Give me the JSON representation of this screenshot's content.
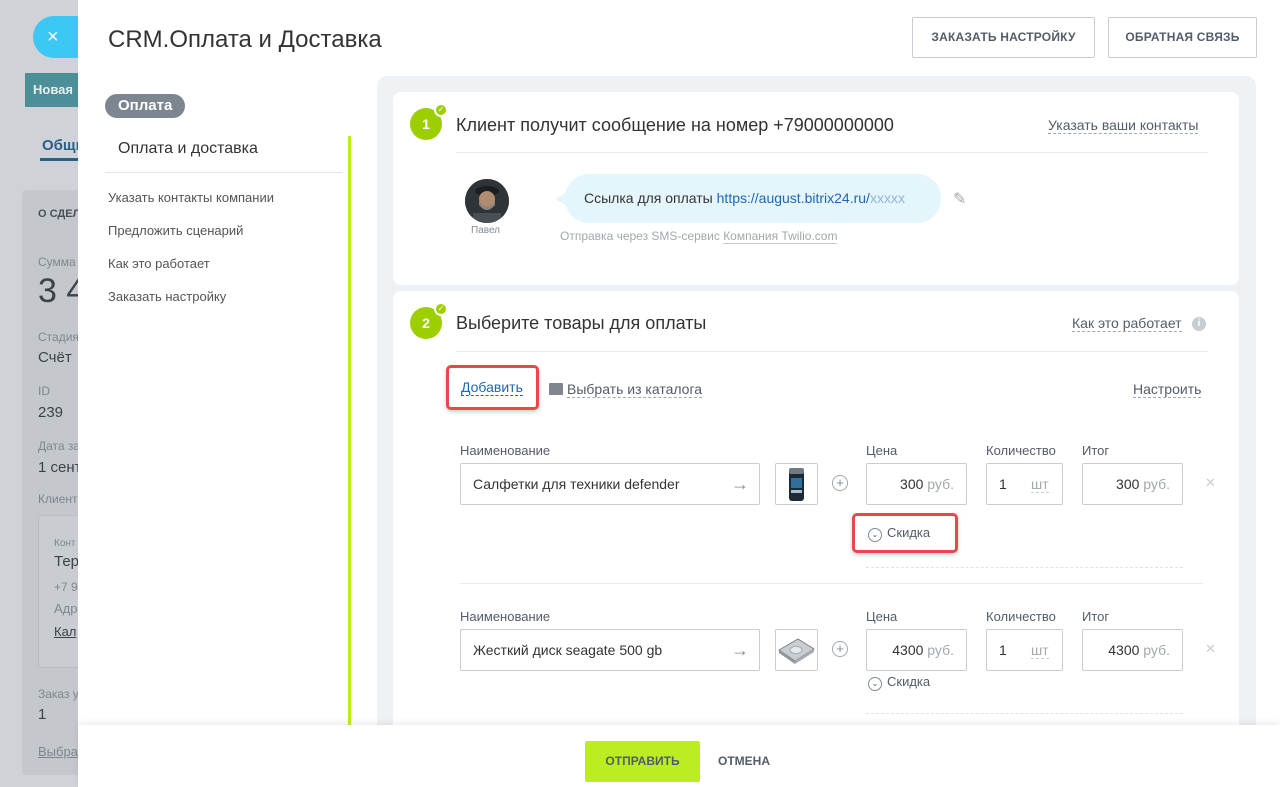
{
  "background": {
    "close_glyph": "×",
    "badge": "Новая",
    "tab": "Общи",
    "section": "О СДЕЛ",
    "fields": [
      {
        "label": "Сумма",
        "value": "3 4"
      },
      {
        "label": "Стадия",
        "value": "Счёт"
      },
      {
        "label": "ID",
        "value": "239"
      },
      {
        "label": "Дата за",
        "value": "1 сент"
      },
      {
        "label": "Клиент",
        "value": ""
      }
    ],
    "contact": {
      "label": "Конт",
      "name": "Тер",
      "phone": "+7 9",
      "addr": "Адр",
      "link": "Кал"
    },
    "order": {
      "label": "Заказ у",
      "value": "1",
      "link": "Выбра"
    }
  },
  "header": {
    "title": "CRM.Оплата и Доставка",
    "order_setup_button": "ЗАКАЗАТЬ НАСТРОЙКУ",
    "feedback_button": "ОБРАТНАЯ СВЯЗЬ"
  },
  "menu": {
    "pill": "Оплата",
    "active": "Оплата и доставка",
    "links": [
      "Указать контакты компании",
      "Предложить сценарий",
      "Как это работает",
      "Заказать настройку"
    ]
  },
  "step1": {
    "number": "1",
    "title": "Клиент получит сообщение на номер +79000000000",
    "contacts_link": "Указать ваши контакты",
    "avatar_name": "Павел",
    "message_prefix": "Ссылка для оплаты ",
    "message_link": "https://august.bitrix24.ru/",
    "message_mask": "xxxxx",
    "sms_prefix": "Отправка через SMS-сервис ",
    "sms_provider": "Компания Twilio.com"
  },
  "step2": {
    "number": "2",
    "title": "Выберите товары для оплаты",
    "how_link": "Как это работает",
    "add_link": "Добавить",
    "catalog_link": "Выбрать из каталога",
    "settings_link": "Настроить",
    "col_name": "Наименование",
    "col_price": "Цена",
    "col_qty": "Количество",
    "col_total": "Итог",
    "discount_label": "Скидка",
    "products": [
      {
        "name": "Салфетки для техники defender",
        "price": "300",
        "currency": "руб.",
        "qty": "1",
        "unit": "шт",
        "total": "300"
      },
      {
        "name": "Жесткий диск seagate 500 gb",
        "price": "4300",
        "currency": "руб.",
        "qty": "1",
        "unit": "шт",
        "total": "4300"
      }
    ]
  },
  "footer": {
    "send_button": "ОТПРАВИТЬ",
    "cancel_button": "ОТМЕНА"
  },
  "colors": {
    "accent_green": "#bbed21",
    "step_green": "#9dcf00",
    "link_blue": "#2067b0",
    "highlight_red": "#e8484a",
    "bubble": "#e4f5fc"
  }
}
